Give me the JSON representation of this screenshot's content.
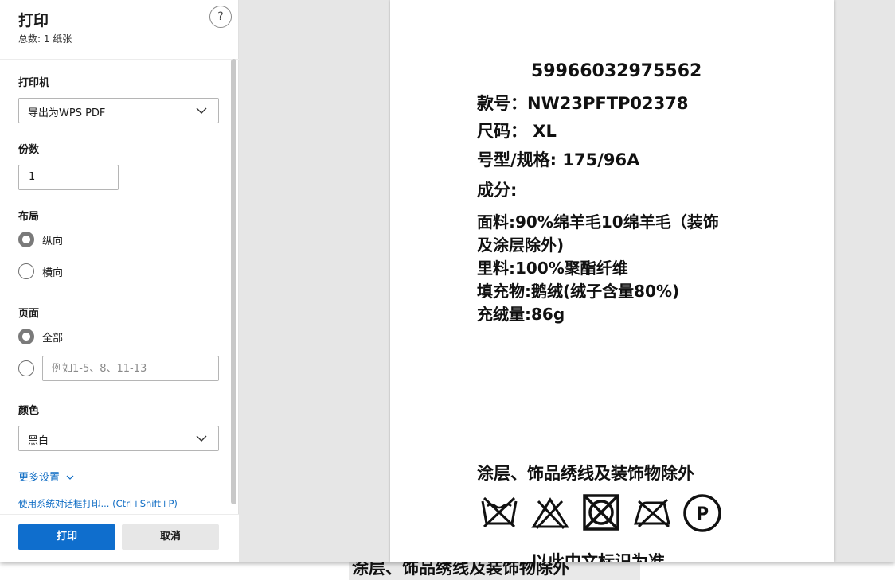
{
  "dialog": {
    "title": "打印",
    "subtitle": "总数: 1 纸张",
    "help_label": "?"
  },
  "printer": {
    "label": "打印机",
    "value": "导出为WPS PDF"
  },
  "copies": {
    "label": "份数",
    "value": "1"
  },
  "layout": {
    "label": "布局",
    "options": [
      {
        "label": "纵向",
        "selected": true
      },
      {
        "label": "横向",
        "selected": false
      }
    ]
  },
  "pages": {
    "label": "页面",
    "all_label": "全部",
    "custom_placeholder": "例如1-5、8、11-13"
  },
  "color": {
    "label": "颜色",
    "value": "黑白"
  },
  "more_settings": "更多设置",
  "system_dialog": "使用系统对话框打印... (Ctrl+Shift+P)",
  "buttons": {
    "print": "打印",
    "cancel": "取消"
  },
  "preview": {
    "barcode_number": "59966032975562",
    "style_line": "款号：NW23PFTP02378",
    "size_line": "尺码： XL",
    "spec_line": "号型/规格: 175/96A",
    "composition_label": "成分:",
    "fabric_line1": "面料:90%绵羊毛10绵羊毛（装饰",
    "fabric_line2": "及涂层除外)",
    "lining_line": "里料:100%聚酯纤维",
    "filling_line": "填充物:鹅绒(绒子含量80%)",
    "fill_amount_line": "充绒量:86g",
    "exclusion_line": "涂层、饰品绣线及装饰物除外",
    "bottom_line": "以此中文标识为准",
    "care_icons": [
      "no-wash-icon",
      "no-bleach-icon",
      "no-tumble-dry-icon",
      "no-iron-icon",
      "dry-clean-p-icon"
    ],
    "dry_clean_letter": "P"
  },
  "background_text": "涂层、饰品绣线及装饰物除外"
}
